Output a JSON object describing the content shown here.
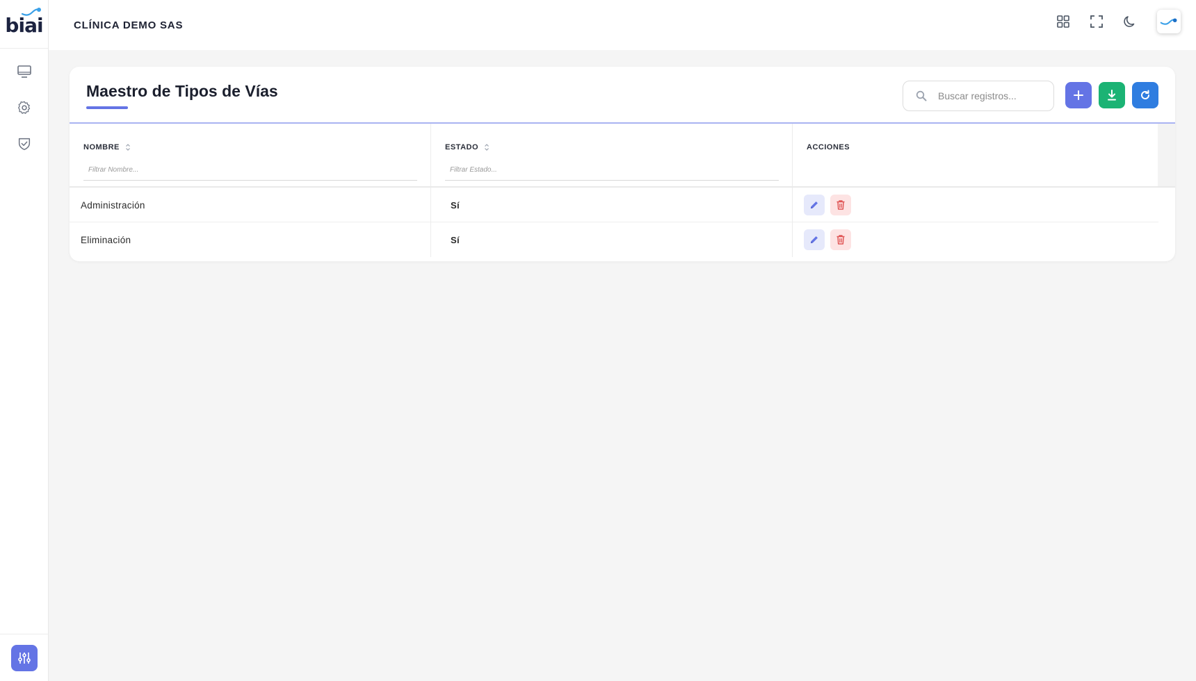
{
  "brand": {
    "logo_text": "biai",
    "logo_icon": "biai-logo"
  },
  "sidebar": {
    "items": [
      {
        "name": "monitor-icon"
      },
      {
        "name": "gear-icon"
      },
      {
        "name": "shield-check-icon"
      }
    ],
    "bottom_button_icon": "sliders-icon"
  },
  "topbar": {
    "company": "CLÍNICA DEMO SAS",
    "actions": [
      "grid-icon",
      "fullscreen-icon",
      "moon-icon",
      "avatar"
    ]
  },
  "card": {
    "title": "Maestro de Tipos de Vías",
    "search_placeholder": "Buscar registros...",
    "buttons": [
      "add",
      "export",
      "refresh"
    ]
  },
  "table": {
    "columns": [
      {
        "label": "NOMBRE",
        "sortable": true,
        "filter_placeholder": "Filtrar Nombre..."
      },
      {
        "label": "ESTADO",
        "sortable": true,
        "filter_placeholder": "Filtrar Estado..."
      },
      {
        "label": "ACCIONES",
        "sortable": false
      }
    ],
    "rows": [
      {
        "nombre": "Administración",
        "estado": "Sí"
      },
      {
        "nombre": "Eliminación",
        "estado": "Sí"
      }
    ]
  },
  "colors": {
    "primary": "#6474e5",
    "success": "#1bb374",
    "info": "#2f7de0",
    "danger": "#e05656",
    "header_border": "#a9b3f2"
  }
}
